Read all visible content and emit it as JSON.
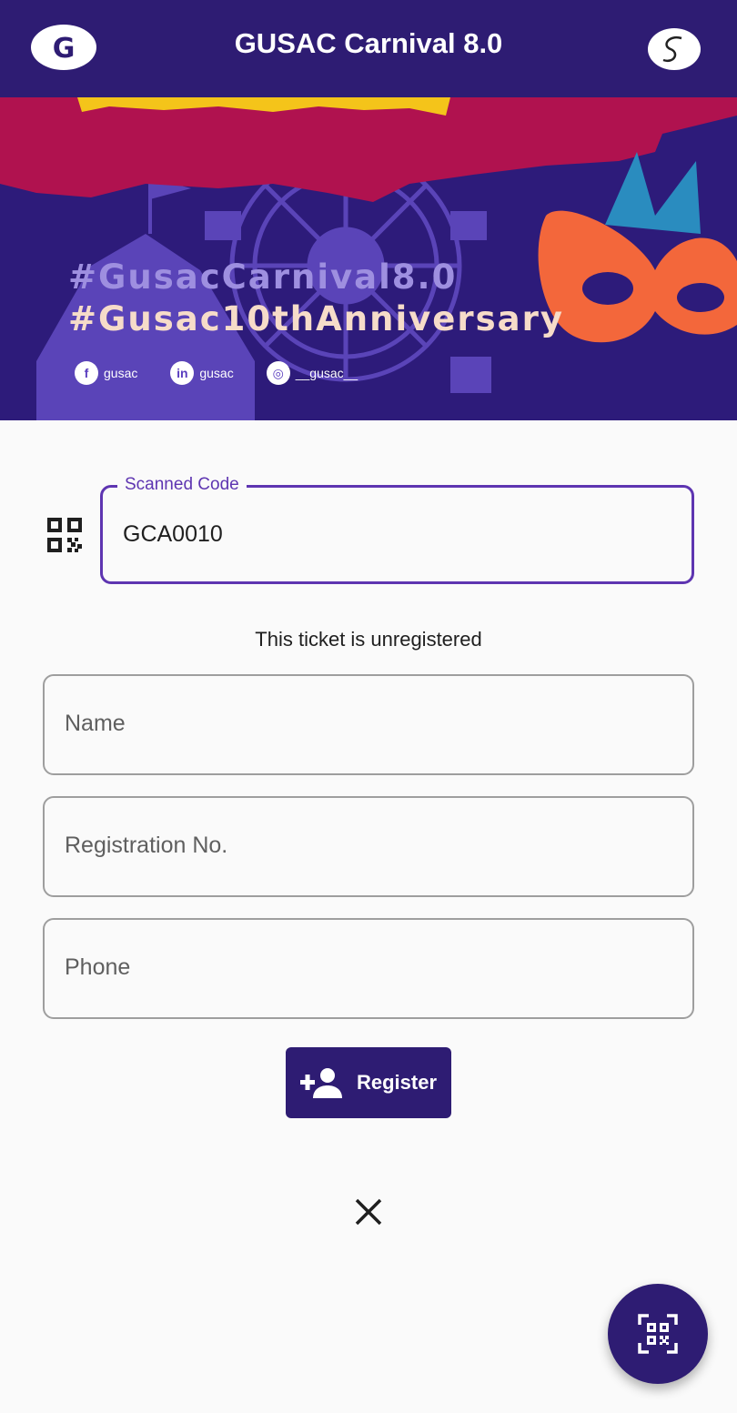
{
  "appbar": {
    "title": "GUSAC Carnival 8.0",
    "left_logo": "gusac-logo-icon",
    "right_logo": "signature-logo-icon",
    "color": "#2e1c73"
  },
  "banner": {
    "hashtag_1": "#GusacCarnival8.0",
    "hashtag_2": "#Gusac10thAnniversary",
    "socials": [
      {
        "icon": "facebook-icon",
        "glyph": "f",
        "handle": "gusac"
      },
      {
        "icon": "linkedin-icon",
        "glyph": "in",
        "handle": "gusac"
      },
      {
        "icon": "instagram-icon",
        "glyph": "◎",
        "handle": "__gusac__"
      }
    ]
  },
  "form": {
    "scanned_code_label": "Scanned Code",
    "scanned_code_value": "GCA0010",
    "status_text": "This ticket is unregistered",
    "name_placeholder": "Name",
    "registration_placeholder": "Registration No.",
    "phone_placeholder": "Phone",
    "register_label": "Register"
  },
  "icons": {
    "qr_prefix": "qr-code-icon",
    "register": "person-add-icon",
    "close": "close-icon",
    "fab": "qr-scan-icon"
  },
  "colors": {
    "primary": "#2e1c73",
    "focus": "#5e35b1",
    "banner_red": "#b0124f",
    "banner_purple": "#2d1b7a"
  }
}
